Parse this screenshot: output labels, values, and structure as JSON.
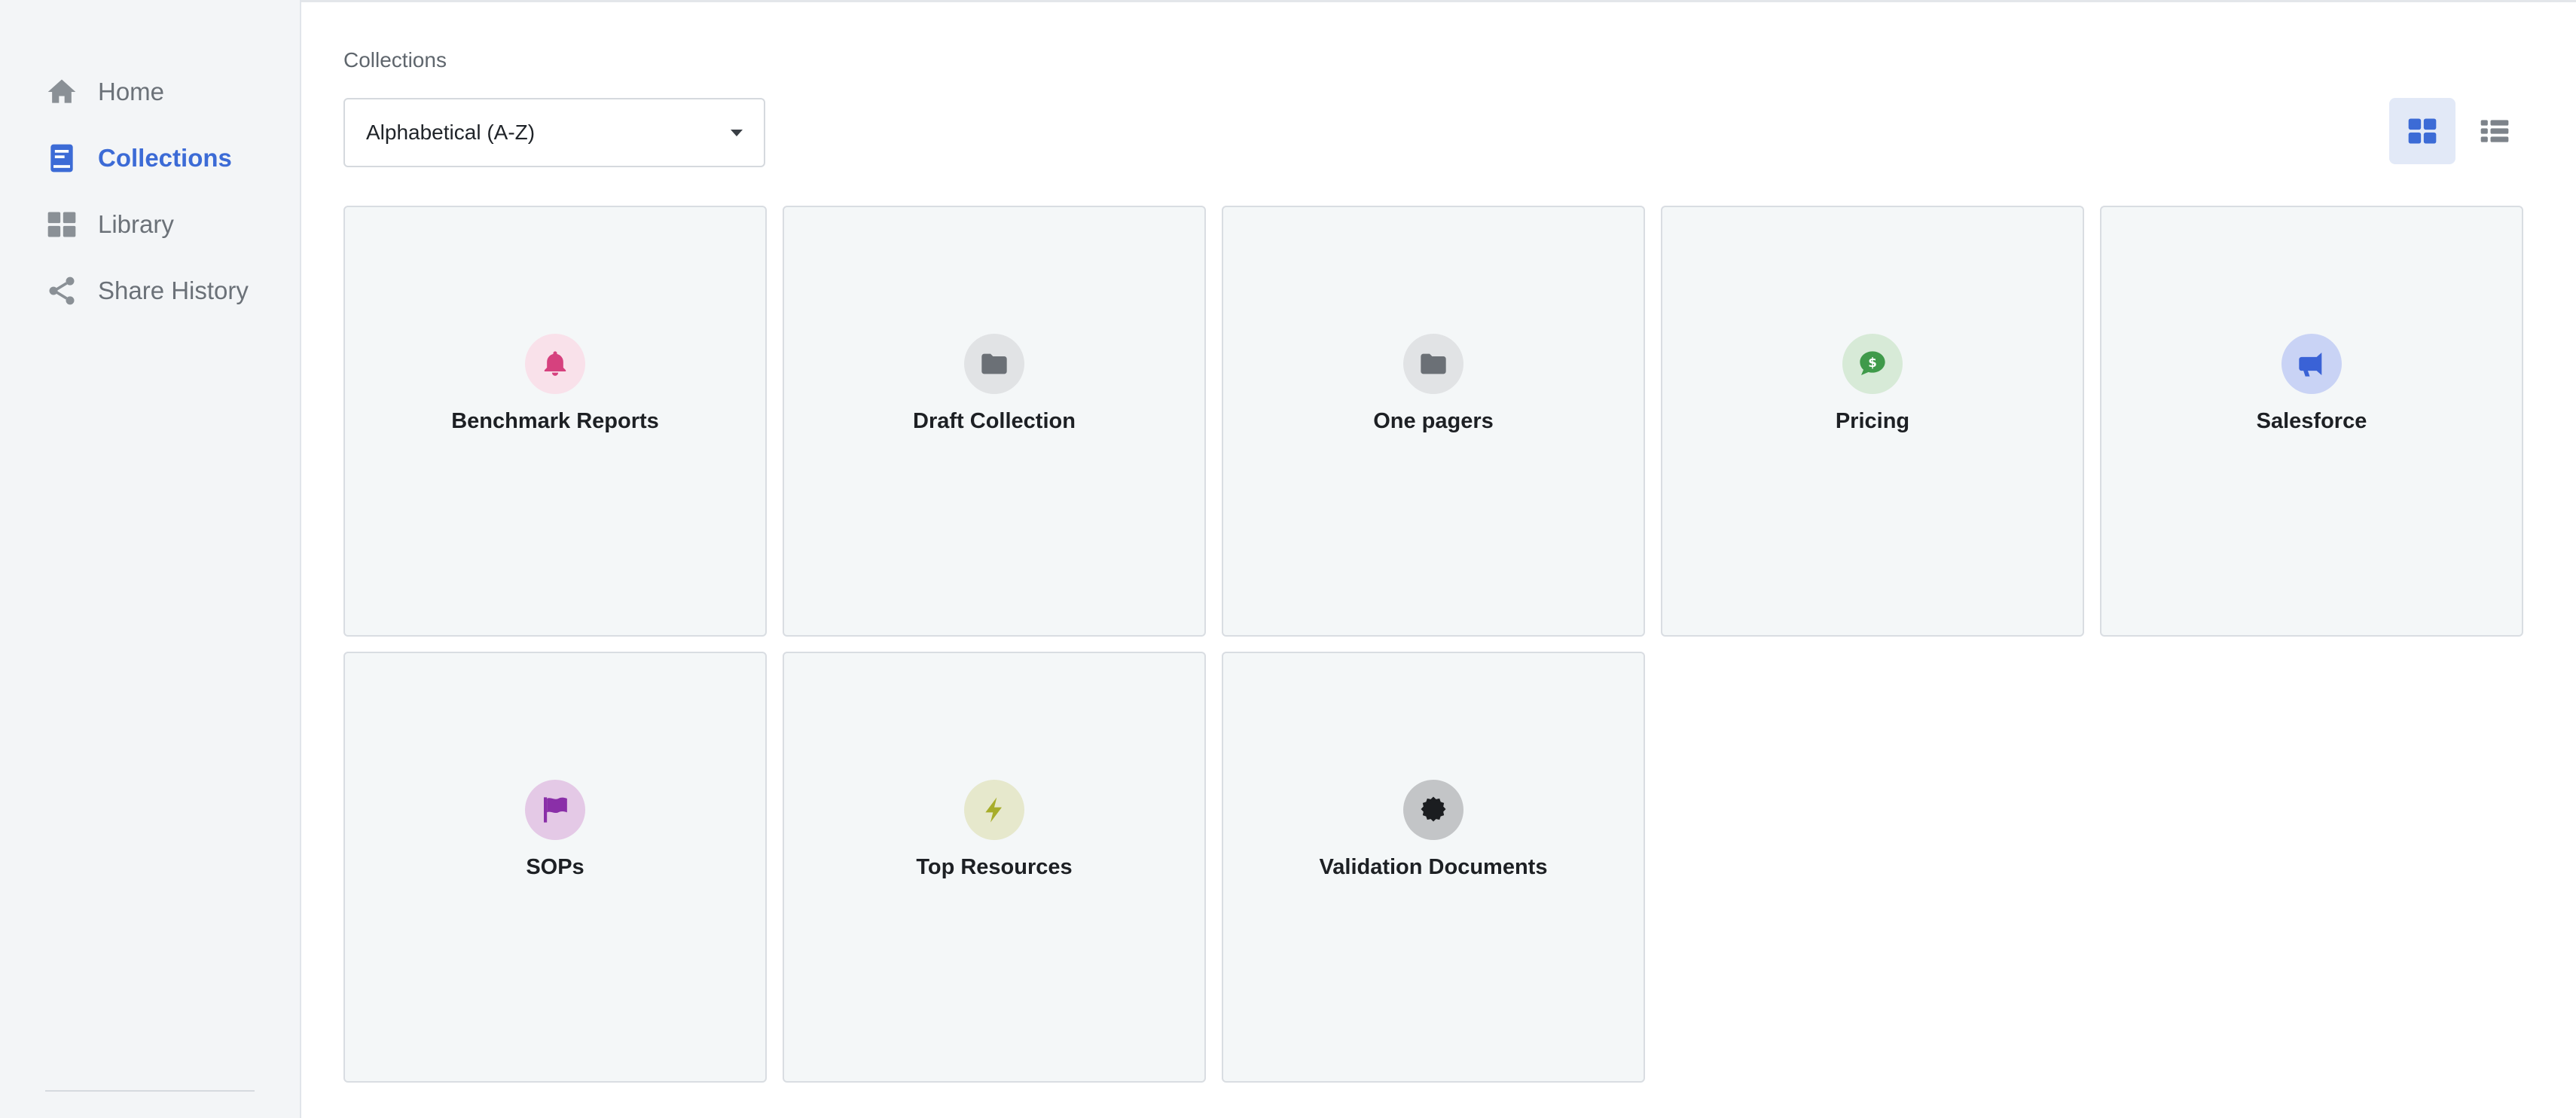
{
  "sidebar": {
    "items": [
      {
        "label": "Home",
        "icon": "home-icon",
        "active": false
      },
      {
        "label": "Collections",
        "icon": "book-icon",
        "active": true
      },
      {
        "label": "Library",
        "icon": "grid-icon",
        "active": false
      },
      {
        "label": "Share History",
        "icon": "share-icon",
        "active": false
      }
    ]
  },
  "main": {
    "title": "Collections",
    "sort": {
      "value": "Alphabetical (A-Z)"
    },
    "view_toggle": {
      "active": "grid"
    }
  },
  "collections": [
    {
      "title": "Benchmark Reports",
      "icon": "bell-icon",
      "badge_bg": "#f9e1ea",
      "icon_color": "#d6417e"
    },
    {
      "title": "Draft Collection",
      "icon": "folder-icon",
      "badge_bg": "#e1e3e5",
      "icon_color": "#6b7076"
    },
    {
      "title": "One pagers",
      "icon": "folder-icon",
      "badge_bg": "#e1e3e5",
      "icon_color": "#6b7076"
    },
    {
      "title": "Pricing",
      "icon": "money-chat-icon",
      "badge_bg": "#d7ead7",
      "icon_color": "#3f9a4a"
    },
    {
      "title": "Salesforce",
      "icon": "megaphone-icon",
      "badge_bg": "#c9d3f5",
      "icon_color": "#3a62d6"
    },
    {
      "title": "SOPs",
      "icon": "flag-icon",
      "badge_bg": "#e4c9e6",
      "icon_color": "#8a2fa8"
    },
    {
      "title": "Top Resources",
      "icon": "bolt-icon",
      "badge_bg": "#e6e8cc",
      "icon_color": "#a7ad2a"
    },
    {
      "title": "Validation Documents",
      "icon": "certificate-icon",
      "badge_bg": "#c3c5c7",
      "icon_color": "#1b1d20"
    }
  ],
  "colors": {
    "accent": "#3c6bd6",
    "sidebar_bg": "#f3f5f7",
    "card_bg": "#f4f7f8"
  }
}
